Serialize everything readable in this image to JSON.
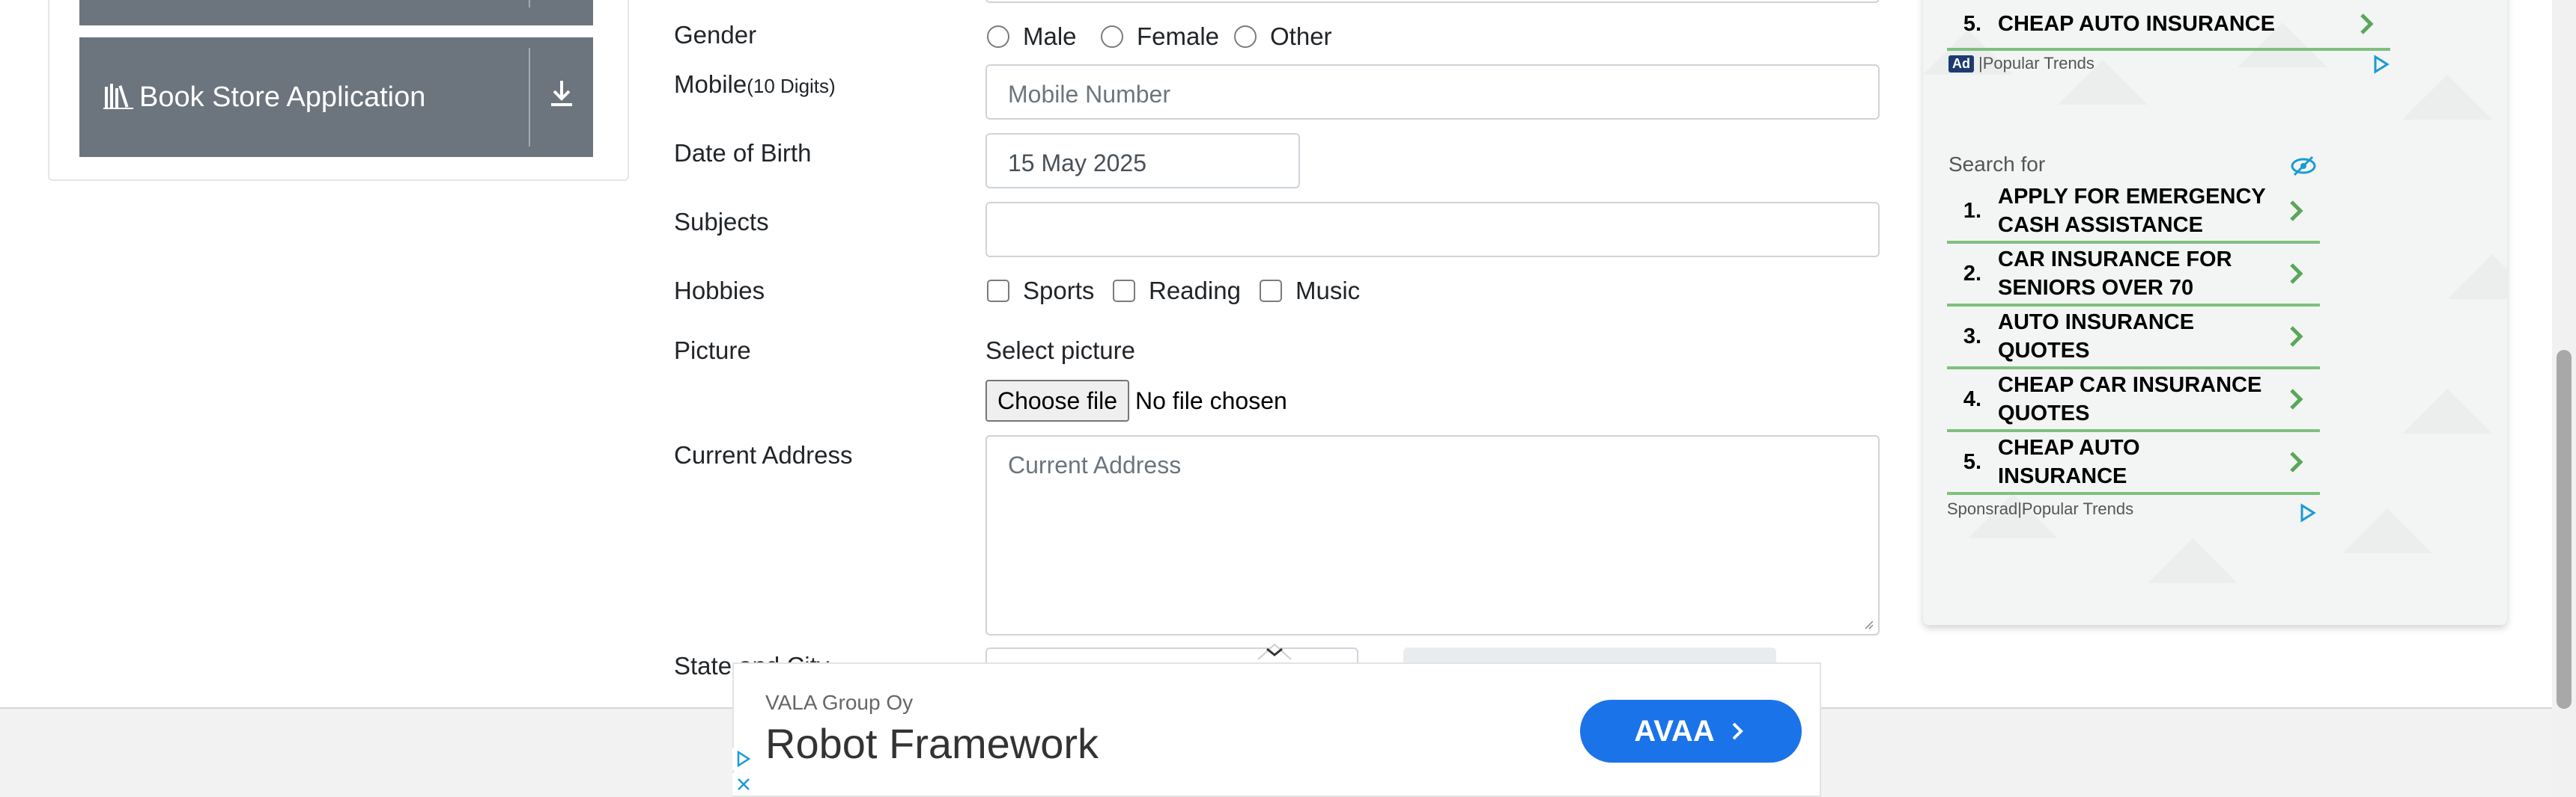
{
  "sidebar": {
    "book_store_label": "Book Store Application"
  },
  "form": {
    "gender": {
      "label": "Gender",
      "options": [
        "Male",
        "Female",
        "Other"
      ]
    },
    "mobile": {
      "label": "Mobile",
      "hint": "(10 Digits)",
      "placeholder": "Mobile Number"
    },
    "dob": {
      "label": "Date of Birth",
      "value": "15 May 2025"
    },
    "subjects": {
      "label": "Subjects",
      "value": ""
    },
    "hobbies": {
      "label": "Hobbies",
      "options": [
        "Sports",
        "Reading",
        "Music"
      ]
    },
    "picture": {
      "label": "Picture",
      "select_text": "Select picture",
      "button_label": "Choose file",
      "status": "No file chosen"
    },
    "address": {
      "label": "Current Address",
      "placeholder": "Current Address"
    },
    "state_city": {
      "label": "State and City"
    }
  },
  "ad_panel": {
    "top_item": {
      "number": "5.",
      "text": "CHEAP AUTO INSURANCE"
    },
    "top_footer": {
      "badge": "Ad",
      "source": "Popular Trends"
    },
    "search_for": "Search for",
    "items": [
      {
        "number": "1.",
        "line1": "APPLY FOR EMERGENCY",
        "line2": "CASH ASSISTANCE"
      },
      {
        "number": "2.",
        "line1": "CAR INSURANCE FOR",
        "line2": "SENIORS OVER 70"
      },
      {
        "number": "3.",
        "line1": "AUTO INSURANCE",
        "line2": "QUOTES"
      },
      {
        "number": "4.",
        "line1": "CHEAP CAR INSURANCE",
        "line2": "QUOTES"
      },
      {
        "number": "5.",
        "line1": "CHEAP AUTO",
        "line2": "INSURANCE"
      }
    ],
    "bottom_footer": {
      "sponsored": "Sponsrad",
      "source": "Popular Trends"
    }
  },
  "bottom_ad": {
    "advertiser": "VALA Group Oy",
    "headline": "Robot Framework",
    "cta": "AVAA"
  },
  "colors": {
    "sidebar_button": "#6c757d",
    "ad_item_underline": "#7fc07f",
    "cta_blue": "#1a73e8"
  }
}
